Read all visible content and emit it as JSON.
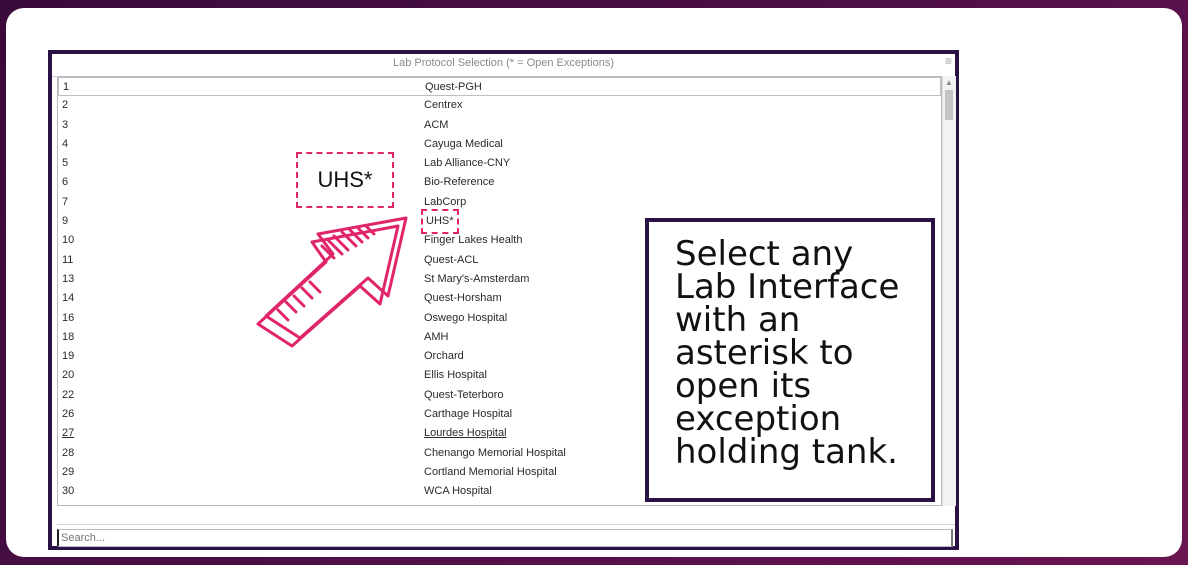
{
  "window": {
    "title": "Lab Protocol Selection (* = Open Exceptions)",
    "menu_icon": "hamburger-menu-icon"
  },
  "rows": [
    {
      "num": "1",
      "name": "Quest-PGH"
    },
    {
      "num": "2",
      "name": "Centrex"
    },
    {
      "num": "3",
      "name": "ACM"
    },
    {
      "num": "4",
      "name": "Cayuga Medical"
    },
    {
      "num": "5",
      "name": "Lab Alliance-CNY"
    },
    {
      "num": "6",
      "name": "Bio-Reference"
    },
    {
      "num": "7",
      "name": "LabCorp"
    },
    {
      "num": "9",
      "name": "UHS*"
    },
    {
      "num": "10",
      "name": "Finger Lakes Health"
    },
    {
      "num": "11",
      "name": "Quest-ACL"
    },
    {
      "num": "13",
      "name": "St Mary's-Amsterdam"
    },
    {
      "num": "14",
      "name": "Quest-Horsham"
    },
    {
      "num": "16",
      "name": "Oswego Hospital"
    },
    {
      "num": "18",
      "name": "AMH"
    },
    {
      "num": "19",
      "name": "Orchard"
    },
    {
      "num": "20",
      "name": "Ellis Hospital"
    },
    {
      "num": "22",
      "name": "Quest-Teterboro"
    },
    {
      "num": "26",
      "name": "Carthage Hospital"
    },
    {
      "num": "27",
      "name": "Lourdes Hospital"
    },
    {
      "num": "28",
      "name": "Chenango Memorial Hospital"
    },
    {
      "num": "29",
      "name": "Cortland Memorial Hospital"
    },
    {
      "num": "30",
      "name": "WCA Hospital"
    }
  ],
  "search": {
    "placeholder": "Search..."
  },
  "callout": {
    "label": "UHS*"
  },
  "instruction": {
    "text": "Select any Lab Interface with an asterisk to open its exception holding tank."
  },
  "colors": {
    "accent": "#e0256a",
    "frame": "#2a1245",
    "background": "#4a0f45"
  }
}
